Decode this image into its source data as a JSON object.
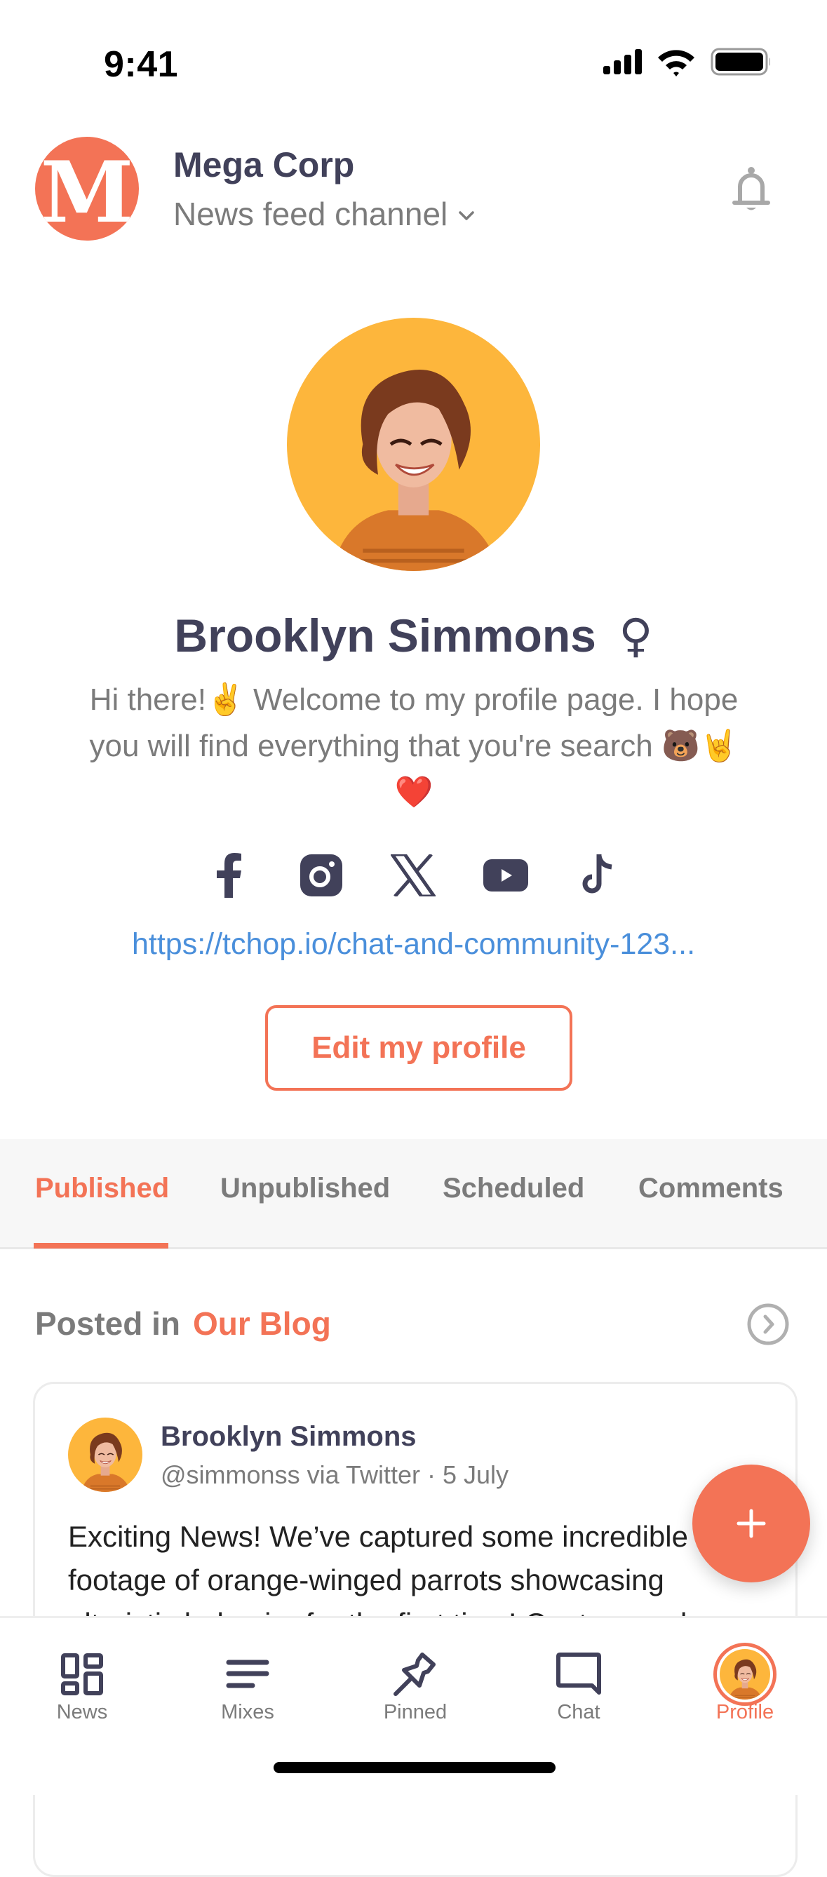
{
  "status_bar": {
    "time": "9:41",
    "icons": [
      "cellular-signal-icon",
      "wifi-icon",
      "battery-icon"
    ]
  },
  "header": {
    "logo_letter": "M",
    "org_name": "Mega Corp",
    "channel_label": "News feed channel",
    "channel_icon": "chevron-down-icon",
    "notifications_icon": "bell-icon"
  },
  "profile": {
    "name": "Brooklyn Simmons",
    "gender_symbol": "♀",
    "bio": "Hi there!✌️ Welcome to my profile page. I hope you will find everything that you're search 🐻🤘❤️",
    "socials": [
      {
        "name": "facebook",
        "icon": "facebook-icon"
      },
      {
        "name": "instagram",
        "icon": "instagram-icon"
      },
      {
        "name": "x",
        "icon": "x-twitter-icon"
      },
      {
        "name": "youtube",
        "icon": "youtube-icon"
      },
      {
        "name": "tiktok",
        "icon": "tiktok-icon"
      }
    ],
    "link": "https://tchop.io/chat-and-community-123...",
    "edit_button": "Edit my profile"
  },
  "tabs": [
    {
      "label": "Published",
      "active": true
    },
    {
      "label": "Unpublished",
      "active": false
    },
    {
      "label": "Scheduled",
      "active": false
    },
    {
      "label": "Comments",
      "active": false
    }
  ],
  "feed": {
    "posted_in_label": "Posted in",
    "channel_name": "Our Blog",
    "open_icon": "chevron-right-circle-icon",
    "post": {
      "author": "Brooklyn Simmons",
      "meta": "@simmonss via Twitter · 5 July",
      "lines": [
        "Exciting News! We’ve captured some incredible",
        "footage of orange-winged parrots showcasing",
        "altruistic behavior for the first time! Capture and"
      ]
    }
  },
  "fab": {
    "icon": "plus-icon"
  },
  "bottom_nav": [
    {
      "label": "News",
      "icon": "news-grid-icon",
      "active": false
    },
    {
      "label": "Mixes",
      "icon": "mixes-lines-icon",
      "active": false
    },
    {
      "label": "Pinned",
      "icon": "pin-icon",
      "active": false
    },
    {
      "label": "Chat",
      "icon": "chat-bubble-icon",
      "active": false
    },
    {
      "label": "Profile",
      "icon": "avatar",
      "active": true
    }
  ],
  "colors": {
    "accent": "#F37356",
    "text_primary": "#41415A",
    "text_secondary": "#7B7B7B",
    "link": "#4A8FDB",
    "avatar_bg": "#FDB63C"
  }
}
